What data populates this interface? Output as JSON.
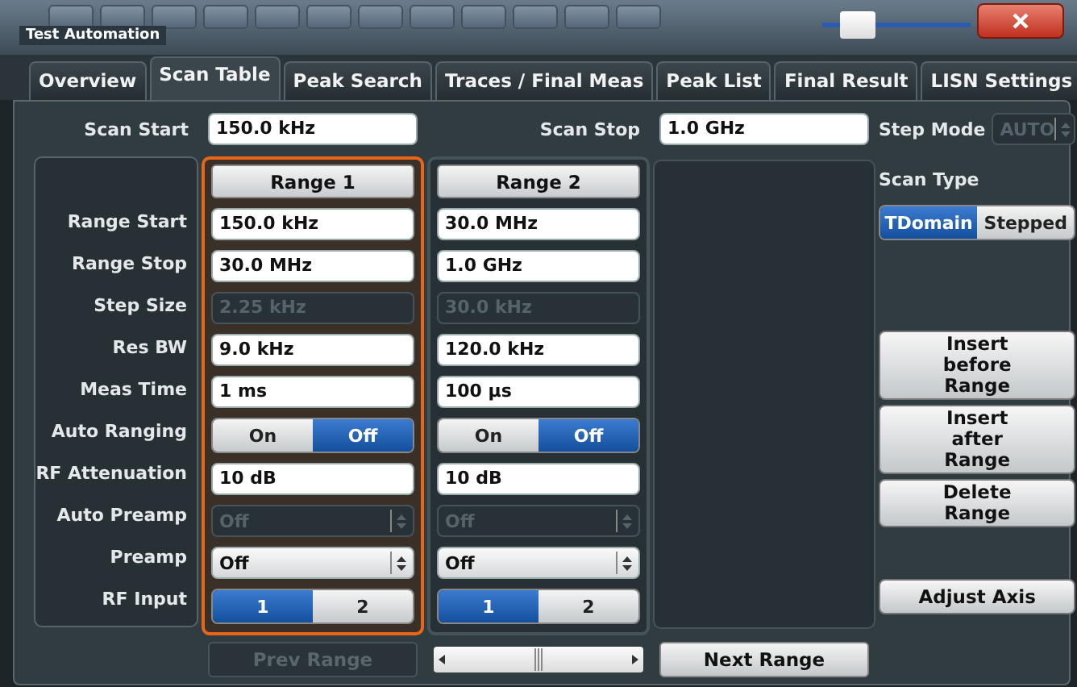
{
  "window": {
    "title": "Test Automation"
  },
  "slider": {
    "level": 0.15
  },
  "tabs": [
    {
      "label": "Overview",
      "selected": false
    },
    {
      "label": "Scan Table",
      "selected": true
    },
    {
      "label": "Peak Search",
      "selected": false
    },
    {
      "label": "Traces / Final Meas",
      "selected": false
    },
    {
      "label": "Peak List",
      "selected": false
    },
    {
      "label": "Final Result",
      "selected": false
    },
    {
      "label": "LISN Settings",
      "selected": false
    }
  ],
  "scan_start": {
    "label": "Scan Start",
    "value": "150.0 kHz"
  },
  "scan_stop": {
    "label": "Scan Stop",
    "value": "1.0 GHz"
  },
  "step_mode": {
    "label": "Step Mode",
    "value": "AUTO",
    "disabled": true
  },
  "row_labels": [
    "Range Start",
    "Range Stop",
    "Step Size",
    "Res BW",
    "Meas Time",
    "Auto Ranging",
    "RF Attenuation",
    "Auto Preamp",
    "Preamp",
    "RF Input"
  ],
  "ranges": [
    {
      "header": "Range 1",
      "selected": true,
      "cells": [
        {
          "kind": "field",
          "value": "150.0 kHz",
          "disabled": false
        },
        {
          "kind": "field",
          "value": "30.0 MHz",
          "disabled": false
        },
        {
          "kind": "field",
          "value": "2.25 kHz",
          "disabled": true
        },
        {
          "kind": "field",
          "value": "9.0 kHz",
          "disabled": false
        },
        {
          "kind": "field",
          "value": "1 ms",
          "disabled": false
        },
        {
          "kind": "toggle",
          "options": [
            {
              "label": "On",
              "selected": false
            },
            {
              "label": "Off",
              "selected": true
            }
          ]
        },
        {
          "kind": "field",
          "value": "10 dB",
          "disabled": false
        },
        {
          "kind": "dropdown",
          "value": "Off",
          "disabled": true
        },
        {
          "kind": "dropdown",
          "value": "Off",
          "disabled": false
        },
        {
          "kind": "toggle",
          "options": [
            {
              "label": "1",
              "selected": true
            },
            {
              "label": "2",
              "selected": false
            }
          ]
        }
      ]
    },
    {
      "header": "Range 2",
      "selected": false,
      "cells": [
        {
          "kind": "field",
          "value": "30.0 MHz",
          "disabled": false
        },
        {
          "kind": "field",
          "value": "1.0 GHz",
          "disabled": false
        },
        {
          "kind": "field",
          "value": "30.0 kHz",
          "disabled": true
        },
        {
          "kind": "field",
          "value": "120.0 kHz",
          "disabled": false
        },
        {
          "kind": "field",
          "value": "100 µs",
          "disabled": false
        },
        {
          "kind": "toggle",
          "options": [
            {
              "label": "On",
              "selected": false
            },
            {
              "label": "Off",
              "selected": true
            }
          ]
        },
        {
          "kind": "field",
          "value": "10 dB",
          "disabled": false
        },
        {
          "kind": "dropdown",
          "value": "Off",
          "disabled": true
        },
        {
          "kind": "dropdown",
          "value": "Off",
          "disabled": false
        },
        {
          "kind": "toggle",
          "options": [
            {
              "label": "1",
              "selected": true
            },
            {
              "label": "2",
              "selected": false
            }
          ]
        }
      ]
    }
  ],
  "scan_type": {
    "label": "Scan Type",
    "options": [
      {
        "label": "TDomain",
        "selected": true
      },
      {
        "label": "Stepped",
        "selected": false
      }
    ]
  },
  "actions": [
    {
      "label": "Insert\nbefore\nRange"
    },
    {
      "label": "Insert\nafter\nRange"
    },
    {
      "label": "Delete\nRange"
    }
  ],
  "adjust_axis": {
    "label": "Adjust Axis"
  },
  "nav": {
    "prev": {
      "label": "Prev Range",
      "disabled": true
    },
    "next": {
      "label": "Next Range",
      "disabled": false
    }
  }
}
